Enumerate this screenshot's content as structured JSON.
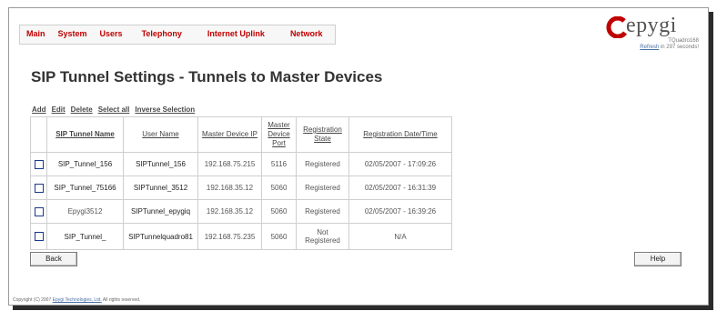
{
  "nav": [
    "Main",
    "System",
    "Users",
    "Telephony",
    "Internet Uplink",
    "Network"
  ],
  "logo": {
    "brand": "epygi",
    "model": "TQuadro168"
  },
  "refresh": {
    "link": "Refresh",
    "text": " in 297 seconds!"
  },
  "page_title": "SIP Tunnel Settings - Tunnels to Master Devices",
  "actions": [
    "Add",
    "Edit",
    "Delete",
    "Select all",
    "Inverse Selection"
  ],
  "table": {
    "headers": [
      "SIP Tunnel Name",
      "User Name",
      "Master Device IP",
      "Master Device Port",
      "Registration State",
      "Registration Date/Time"
    ],
    "rows": [
      {
        "tunnel_name": "SIP_Tunnel_156",
        "user_name": "SIPTunnel_156",
        "ip": "192.168.75.215",
        "port": "5116",
        "state": "Registered",
        "datetime": "02/05/2007 - 17:09:26"
      },
      {
        "tunnel_name": "SIP_Tunnel_75166",
        "user_name": "SIPTunnel_3512",
        "ip": "192.168.35.12",
        "port": "5060",
        "state": "Registered",
        "datetime": "02/05/2007 - 16:31:39"
      },
      {
        "tunnel_name": "Epygi3512",
        "user_name": "SIPTunnel_epygiq",
        "ip": "192.168.35.12",
        "port": "5060",
        "state": "Registered",
        "datetime": "02/05/2007 - 16:39:26"
      },
      {
        "tunnel_name": "SIP_Tunnel_",
        "user_name": "SIPTunnelquadro81",
        "ip": "192.168.75.235",
        "port": "5060",
        "state": "Not Registered",
        "datetime": "N/A"
      }
    ]
  },
  "buttons": {
    "back": "Back",
    "help": "Help"
  },
  "copyright": {
    "prefix": "Copyright (C) 2007 ",
    "link": "Epygi Technologies, Ltd.",
    "suffix": " All rights reserved."
  },
  "colors": {
    "nav_text": "#c00000",
    "logo_red": "#c00000"
  }
}
